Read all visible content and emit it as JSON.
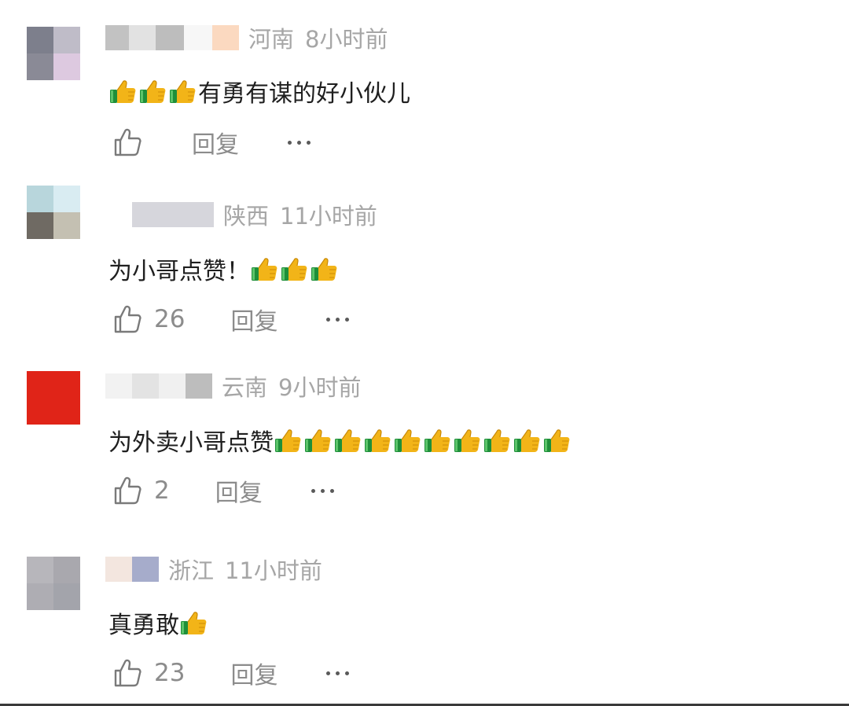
{
  "comments": [
    {
      "region": "河南",
      "time": "8小时前",
      "text": "有勇有谋的好小伙儿",
      "leading_thumbs": 3,
      "trailing_thumbs": 0,
      "likes": "",
      "reply_label": "回复",
      "avatar_colors": [
        "#7d7f8c",
        "#bfbcc8",
        "#8a8a96",
        "#ddc9e0"
      ],
      "name_colors": [
        "#c2c2c2",
        "#e2e2e2",
        "#bdbdbd",
        "#f7f7f7",
        "#fbd9c0"
      ]
    },
    {
      "region": "陕西",
      "time": "11小时前",
      "text": "为小哥点赞！",
      "leading_thumbs": 0,
      "trailing_thumbs": 3,
      "likes": "26",
      "reply_label": "回复",
      "avatar_colors": [
        "#b8d6dc",
        "#d9ecf2",
        "#6f6a63",
        "#c4c0b2"
      ],
      "name_colors": [
        "#d6d6dc"
      ]
    },
    {
      "region": "云南",
      "time": "9小时前",
      "text": "为外卖小哥点赞",
      "leading_thumbs": 0,
      "trailing_thumbs": 10,
      "likes": "2",
      "reply_label": "回复",
      "avatar_colors": [
        "#e02418",
        "#e02418",
        "#e02418",
        "#e02418"
      ],
      "name_colors": [
        "#f2f2f2",
        "#e3e3e3",
        "#f0f0f0",
        "#bdbdbd"
      ]
    },
    {
      "region": "浙江",
      "time": "11小时前",
      "text": "真勇敢",
      "leading_thumbs": 0,
      "trailing_thumbs": 1,
      "likes": "23",
      "reply_label": "回复",
      "avatar_colors": [
        "#b7b6bb",
        "#a9a8ae",
        "#aeadb3",
        "#a3a4ab"
      ],
      "name_colors": [
        "#f3e6df",
        "#a6accb"
      ]
    }
  ],
  "icons": {
    "like": "thumbs-up-outline-icon",
    "emoji": "thumbs-up-emoji-icon",
    "more": "more-dots-icon"
  },
  "colors": {
    "meta_text": "#a6a6a6",
    "action_text": "#8c8c8c",
    "thumb_gold": "#f2b418",
    "thumb_cuff": "#1f8f3a"
  }
}
